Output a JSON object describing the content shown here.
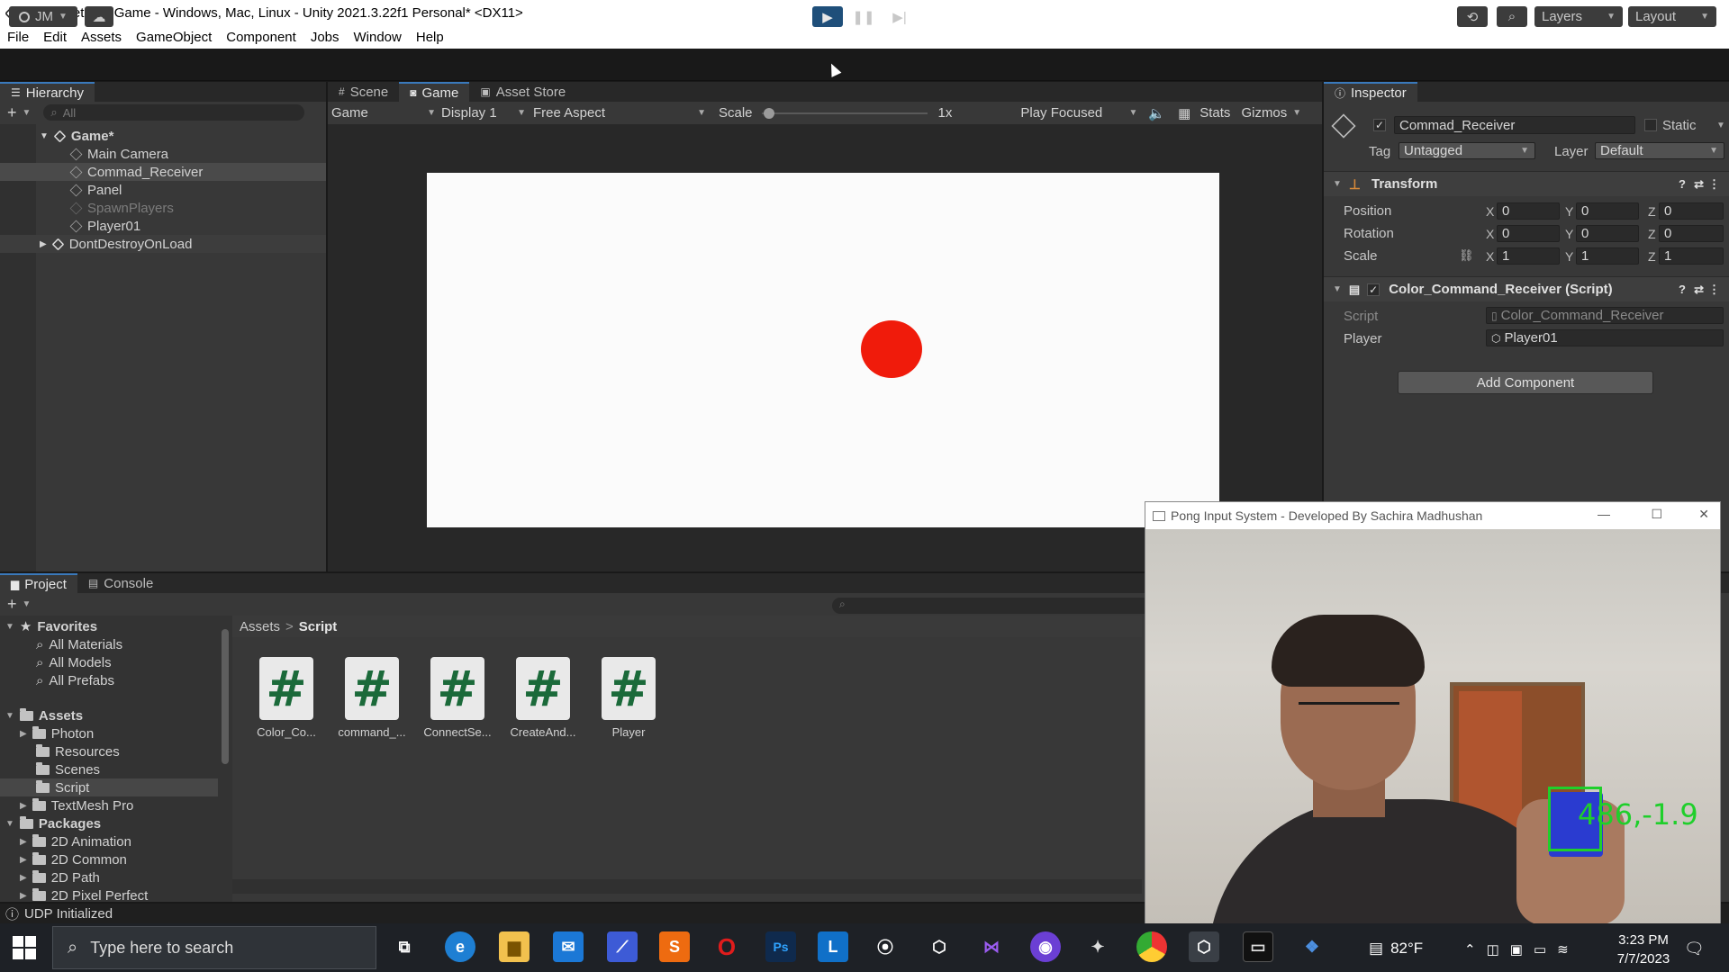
{
  "window": {
    "title": "Hand Detect - Game - Windows, Mac, Linux - Unity 2021.3.22f1 Personal* <DX11>",
    "minimize": "—",
    "maximize": "❐",
    "close": "✕"
  },
  "menu": [
    "File",
    "Edit",
    "Assets",
    "GameObject",
    "Component",
    "Jobs",
    "Window",
    "Help"
  ],
  "toolbar": {
    "account": "JM",
    "layers": "Layers",
    "layout": "Layout"
  },
  "hierarchy": {
    "tab": "Hierarchy",
    "search_placeholder": "All",
    "scene": "Game*",
    "items": [
      "Main Camera",
      "Commad_Receiver",
      "Panel",
      "SpawnPlayers",
      "Player01"
    ],
    "dontdestroy": "DontDestroyOnLoad"
  },
  "game_tabs": [
    "Scene",
    "Game",
    "Asset Store"
  ],
  "game_bar": {
    "mode": "Game",
    "display": "Display 1",
    "aspect": "Free Aspect",
    "scale_label": "Scale",
    "scale_value": "1x",
    "play_focused": "Play Focused",
    "stats": "Stats",
    "gizmos": "Gizmos"
  },
  "inspector": {
    "tab": "Inspector",
    "object_name": "Commad_Receiver",
    "static_label": "Static",
    "tag_label": "Tag",
    "tag_value": "Untagged",
    "layer_label": "Layer",
    "layer_value": "Default",
    "transform": {
      "title": "Transform",
      "position_label": "Position",
      "rotation_label": "Rotation",
      "scale_label": "Scale",
      "axis_x": "X",
      "axis_y": "Y",
      "axis_z": "Z",
      "position": [
        "0",
        "0",
        "0"
      ],
      "rotation": [
        "0",
        "0",
        "0"
      ],
      "scale": [
        "1",
        "1",
        "1"
      ]
    },
    "script_component": {
      "title": "Color_Command_Receiver (Script)",
      "script_label": "Script",
      "script_value": "Color_Command_Receiver",
      "player_label": "Player",
      "player_value": "Player01"
    },
    "add_component": "Add Component"
  },
  "project": {
    "tabs": [
      "Project",
      "Console"
    ],
    "breadcrumb_root": "Assets",
    "breadcrumb_sep": ">",
    "breadcrumb_current": "Script",
    "favorites": {
      "label": "Favorites",
      "items": [
        "All Materials",
        "All Models",
        "All Prefabs"
      ]
    },
    "assets": {
      "label": "Assets",
      "items": [
        "Photon",
        "Resources",
        "Scenes",
        "Script",
        "TextMesh Pro"
      ]
    },
    "packages": {
      "label": "Packages",
      "items": [
        "2D Animation",
        "2D Common",
        "2D Path",
        "2D Pixel Perfect"
      ]
    },
    "files": [
      "Color_Co...",
      "command_...",
      "ConnectSe...",
      "CreateAnd...",
      "Player"
    ],
    "file_glyph": "#"
  },
  "status_bar": "UDP Initialized",
  "camera_window": {
    "title": "Pong Input System - Developed By Sachira Madhushan",
    "overlay_text": "486,-1.9"
  },
  "taskbar": {
    "search_placeholder": "Type here to search",
    "weather": "82°F",
    "time": "3:23 PM",
    "date": "7/7/2023"
  },
  "colors": {
    "game_bg": "#fbfbfb",
    "ball": "#f01b0b",
    "accent": "#3a79bb",
    "overlay_green": "#1fcf2b"
  }
}
